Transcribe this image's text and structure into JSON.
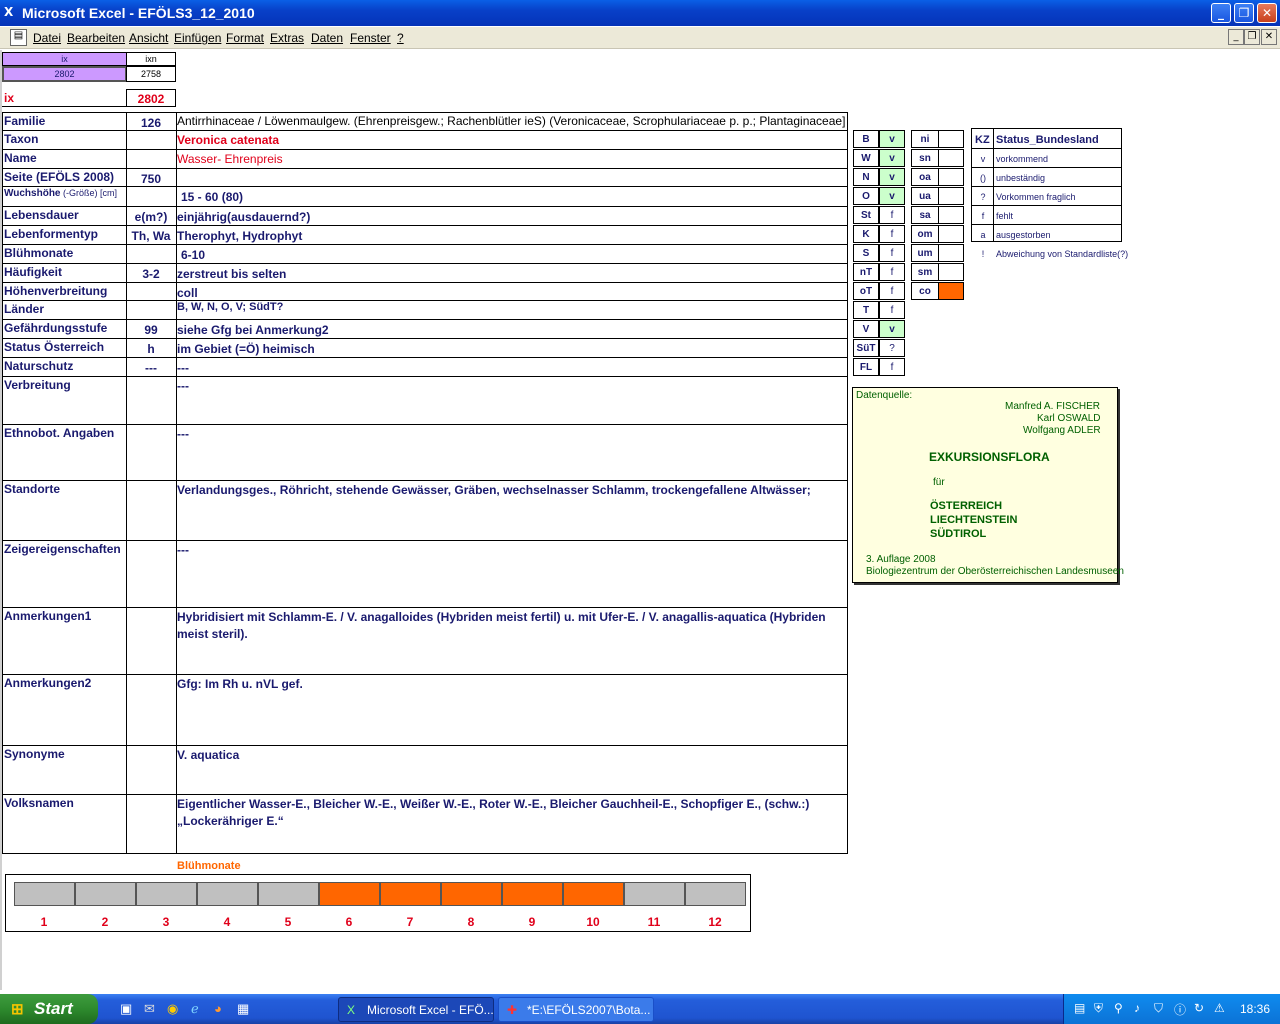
{
  "window": {
    "title": "Microsoft Excel - EFÖLS3_12_2010"
  },
  "menu": [
    "Datei",
    "Bearbeiten",
    "Ansicht",
    "Einfügen",
    "Format",
    "Extras",
    "Daten",
    "Fenster",
    "?"
  ],
  "ix_header": {
    "ix_label": "ix",
    "ixn_label": "ixn",
    "ix_value": "2802",
    "ixn_value": "2758"
  },
  "ix_row": {
    "label": "ix",
    "value": "2802"
  },
  "rows": [
    {
      "label": "Familie",
      "code": "126",
      "value": "Antirrhinaceae  /  Löwenmaulgew. (Ehrenpreisgew.; Rachenblütler ieS) (Veronicaceae, Scrophulariaceae p. p.; Plantaginaceae]"
    },
    {
      "label": "Taxon",
      "code": "",
      "value": "Veronica catenata"
    },
    {
      "label": "Name",
      "code": "",
      "value": "Wasser- Ehrenpreis"
    },
    {
      "label": "Seite (EFÖLS 2008)",
      "code": "750",
      "value": ""
    },
    {
      "label": "Wuchshöhe",
      "label_small": "(-Größe) [cm]",
      "code": "",
      "value": "15 - 60 (80)"
    },
    {
      "label": "Lebensdauer",
      "code": "e(m?)",
      "value": "einjährig(ausdauernd?)"
    },
    {
      "label": "Lebenformentyp",
      "code": "Th, Wa",
      "value": "Therophyt, Hydrophyt"
    },
    {
      "label": "Blühmonate",
      "code": "",
      "value": "6-10"
    },
    {
      "label": "Häufigkeit",
      "code": "3-2",
      "value": "zerstreut bis selten"
    },
    {
      "label": "Höhenverbreitung",
      "code": "",
      "value": "coll"
    },
    {
      "label": "Länder",
      "code": "",
      "value": "B, W, N, O, V; SüdT?"
    },
    {
      "label": "Gefährdungsstufe",
      "code": "99",
      "value": "siehe Gfg bei Anmerkung2"
    },
    {
      "label": "Status Österreich",
      "code": "h",
      "value": "im Gebiet (=Ö) heimisch"
    },
    {
      "label": "Naturschutz",
      "code": "---",
      "value": "---"
    },
    {
      "label": "Verbreitung",
      "code": "",
      "value": "---"
    },
    {
      "label": "Ethnobot. Angaben",
      "code": "",
      "value": "---"
    },
    {
      "label": "Standorte",
      "code": "",
      "value": "Verlandungsges., Röhricht, stehende Gewässer, Gräben, wechselnasser Schlamm, trockengefallene Altwässer;"
    },
    {
      "label": "Zeigereigenschaften",
      "code": "",
      "value": "---"
    },
    {
      "label": "Anmerkungen1",
      "code": "",
      "value": "Hybridisiert mit Schlamm-E. / V. anagalloides (Hybriden meist fertil) u. mit Ufer-E. / V. anagallis-aquatica (Hybriden",
      "value2": "meist steril)."
    },
    {
      "label": "Anmerkungen2",
      "code": "",
      "value": "Gfg:  Im Rh u. nVL gef."
    },
    {
      "label": "Synonyme",
      "code": "",
      "value": "V. aquatica"
    },
    {
      "label": "Volksnamen",
      "code": "",
      "value": "Eigentlicher Wasser-E., Bleicher W.-E., Weißer W.-E., Roter W.-E.,  Bleicher Gauchheil-E., Schopfiger E., (schw.:)",
      "value2": "„Lockerähriger E.“"
    }
  ],
  "states": [
    {
      "code": "B",
      "status": "v"
    },
    {
      "code": "W",
      "status": "v"
    },
    {
      "code": "N",
      "status": "v"
    },
    {
      "code": "O",
      "status": "v"
    },
    {
      "code": "St",
      "status": "f"
    },
    {
      "code": "K",
      "status": "f"
    },
    {
      "code": "S",
      "status": "f"
    },
    {
      "code": "nT",
      "status": "f"
    },
    {
      "code": "oT",
      "status": "f"
    },
    {
      "code": "T",
      "status": "f"
    },
    {
      "code": "V",
      "status": "v"
    },
    {
      "code": "SüT",
      "status": "?"
    },
    {
      "code": "FL",
      "status": "f"
    }
  ],
  "alt_regions": [
    "ni",
    "sn",
    "oa",
    "ua",
    "sa",
    "om",
    "um",
    "sm",
    "co"
  ],
  "legend": {
    "header_kz": "KZ",
    "header_status": "Status_Bundesland",
    "items": [
      {
        "kz": "v",
        "text": "vorkommend"
      },
      {
        "kz": "()",
        "text": "unbeständig"
      },
      {
        "kz": "?",
        "text": "Vorkommen fraglich"
      },
      {
        "kz": "f",
        "text": "fehlt"
      },
      {
        "kz": "a",
        "text": "ausgestorben"
      },
      {
        "kz": "!",
        "text": "Abweichung von Standardliste(?)"
      }
    ]
  },
  "source": {
    "label": "Datenquelle:",
    "authors": [
      "Manfred A. FISCHER",
      "Karl OSWALD",
      "Wolfgang ADLER"
    ],
    "title": "EXKURSIONSFLORA",
    "for": "für",
    "countries": [
      "ÖSTERREICH",
      "LIECHTENSTEIN",
      "SÜDTIROL"
    ],
    "edition": "3. Auflage 2008",
    "publisher": "Biologiezentrum der Oberösterreichischen Landesmuseen"
  },
  "bloom_chart": {
    "title": "Blühmonate",
    "months": [
      "1",
      "2",
      "3",
      "4",
      "5",
      "6",
      "7",
      "8",
      "9",
      "10",
      "11",
      "12"
    ],
    "active": [
      6,
      7,
      8,
      9,
      10
    ],
    "active_color": "#ff6600",
    "inactive_color": "#c0c0c0"
  },
  "taskbar": {
    "start": "Start",
    "tasks": [
      "Microsoft Excel - EFÖ...",
      "*E:\\EFÖLS2007\\Bota..."
    ],
    "clock": "18:36"
  },
  "colors": {
    "ix_purple": "#cc99ff",
    "green_cell": "#ccffcc",
    "orange": "#ff6600"
  }
}
